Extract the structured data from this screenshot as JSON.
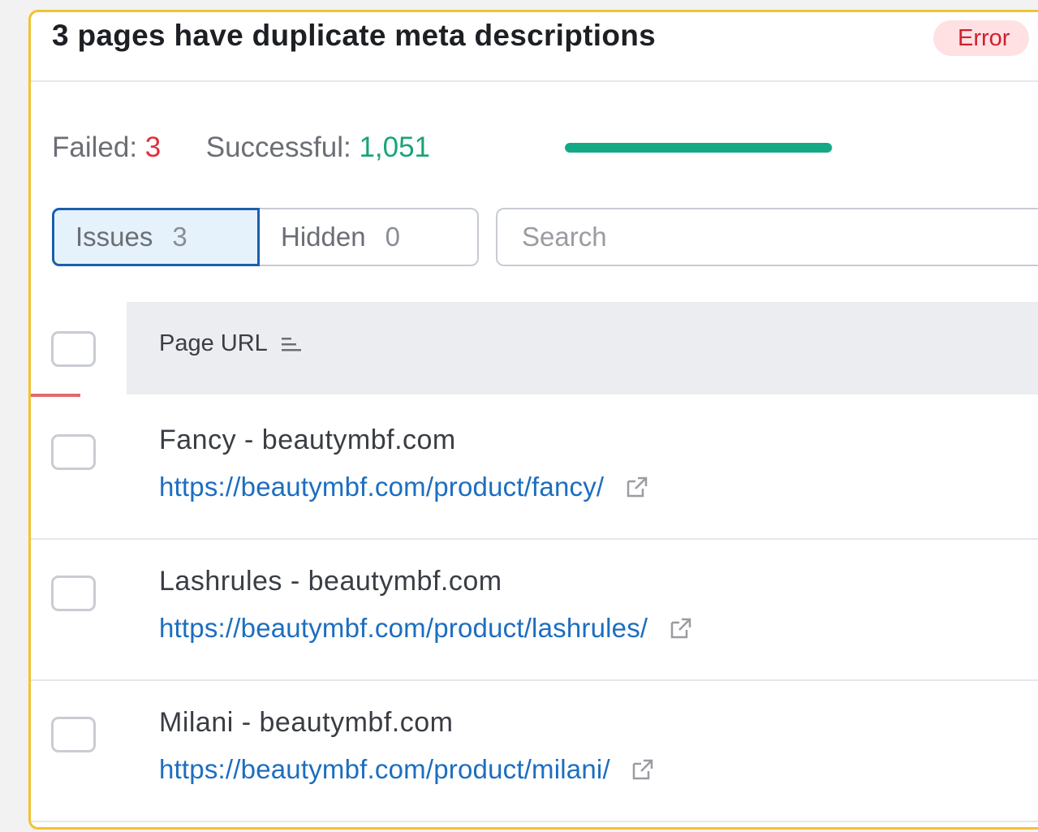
{
  "issue": {
    "title": "3 pages have duplicate meta descriptions",
    "badge": "Error"
  },
  "stats": {
    "failed_label": "Failed:",
    "failed_value": "3",
    "success_label": "Successful:",
    "success_value": "1,051",
    "success_ratio": 0.997
  },
  "tabs": [
    {
      "label": "Issues",
      "count": "3",
      "active": true
    },
    {
      "label": "Hidden",
      "count": "0",
      "active": false
    }
  ],
  "search": {
    "placeholder": "Search",
    "value": ""
  },
  "table": {
    "column_header": "Page URL",
    "rows": [
      {
        "title": "Fancy - beautymbf.com",
        "url": "https://beautymbf.com/product/fancy/"
      },
      {
        "title": "Lashrules - beautymbf.com",
        "url": "https://beautymbf.com/product/lashrules/"
      },
      {
        "title": "Milani - beautymbf.com",
        "url": "https://beautymbf.com/product/milani/"
      }
    ]
  },
  "colors": {
    "accent_border": "#f2c232",
    "error_red": "#e0303a",
    "success_green": "#13a985",
    "link_blue": "#1c6ec0"
  },
  "icons": {
    "sort": "sort-lines-icon",
    "external": "external-link-icon"
  }
}
